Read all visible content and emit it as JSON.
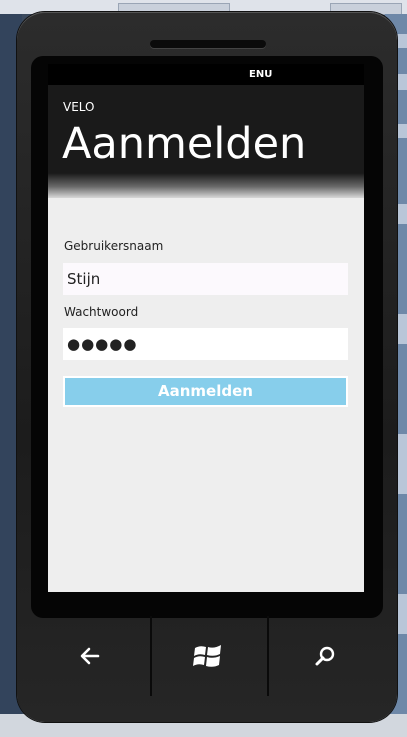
{
  "statusbar": {
    "language": "ENU"
  },
  "app": {
    "title": "VELO"
  },
  "page": {
    "title": "Aanmelden"
  },
  "form": {
    "username_label": "Gebruikersnaam",
    "username_value": "Stijn",
    "password_label": "Wachtwoord",
    "password_value": "●●●●●",
    "submit_label": "Aanmelden"
  },
  "hardware_buttons": [
    {
      "icon": "back-arrow-icon"
    },
    {
      "icon": "windows-logo-icon"
    },
    {
      "icon": "search-icon"
    }
  ],
  "colors": {
    "accent": "#87ceeb",
    "header_bg": "#1a1a1a",
    "screen_bg": "#eeeeee"
  }
}
